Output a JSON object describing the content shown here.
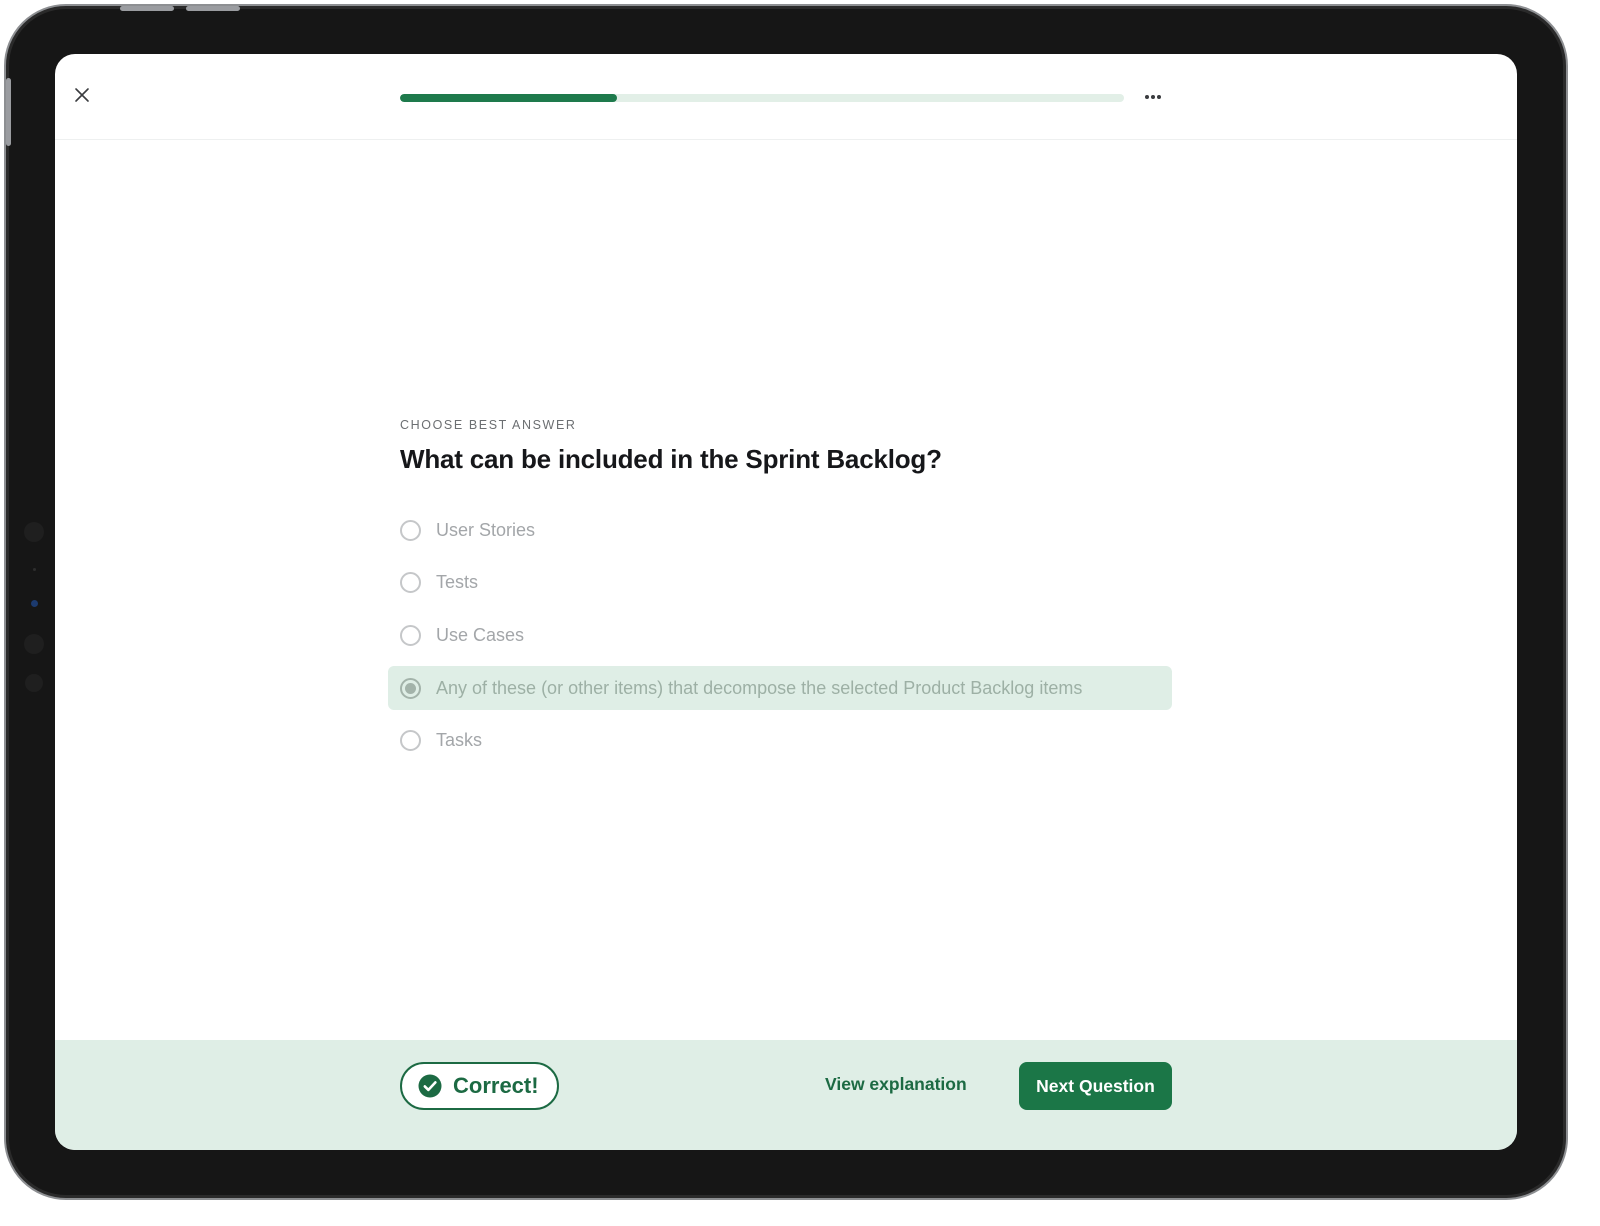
{
  "header": {
    "close_icon": "close-icon",
    "more_icon": "more-horizontal-icon",
    "progress_fraction": 0.3
  },
  "question": {
    "eyebrow": "CHOOSE BEST ANSWER",
    "text": "What can be included in the Sprint Backlog?",
    "options": [
      {
        "label": "User Stories",
        "selected": false
      },
      {
        "label": "Tests",
        "selected": false
      },
      {
        "label": "Use Cases",
        "selected": false
      },
      {
        "label": "Any of these (or other items) that decompose the selected Product Backlog items",
        "selected": true
      },
      {
        "label": "Tasks",
        "selected": false
      }
    ]
  },
  "footer": {
    "result_icon": "check-circle-icon",
    "result_label": "Correct!",
    "explanation_link": "View explanation",
    "next_button": "Next Question"
  },
  "colors": {
    "accent": "#1b7647",
    "accent_light": "#dfeee6",
    "progress_track": "#e2efe7"
  }
}
